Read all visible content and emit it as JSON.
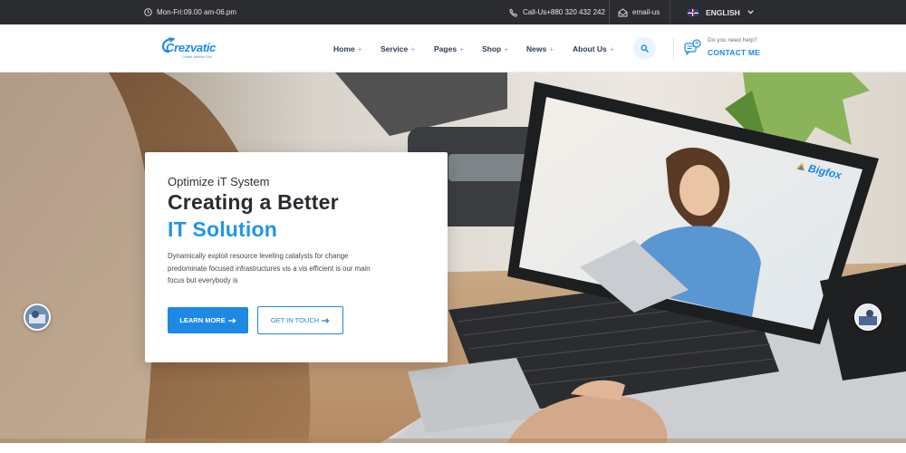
{
  "topbar": {
    "hours": "Mon-Fri:09.00 am-06.pm",
    "call": "Call-Us+880 320 432 242",
    "email": "email-us",
    "language": "ENGLISH",
    "icons": {
      "clock": "clock-icon",
      "phone": "phone-icon",
      "email": "email-icon",
      "flag": "uk-flag-icon",
      "chevron": "chevron-down-icon"
    }
  },
  "header": {
    "logo": {
      "name": "Crezvatic",
      "tagline": "Create Wealth Don"
    },
    "nav": [
      {
        "label": "Home",
        "plus": "+"
      },
      {
        "label": "Service",
        "plus": "+"
      },
      {
        "label": "Pages",
        "plus": "+"
      },
      {
        "label": "Shop",
        "plus": "+"
      },
      {
        "label": "News",
        "plus": "+"
      },
      {
        "label": "About Us",
        "plus": "+"
      }
    ],
    "help": {
      "question": "Do you need help?",
      "cta": "CONTACT ME"
    }
  },
  "hero": {
    "eyebrow": "Optimize iT System",
    "title_line1": "Creating a Better",
    "title_line2": "IT Solution",
    "description": "Dynamically exploit resource leveling catalysts for change predominate focused infrastructures vis a vis efficient is our main focus but everybody is",
    "primary_button": "LEARN MORE",
    "secondary_button": "GET IN TOUCH",
    "screen_brand": "Bigfox"
  },
  "colors": {
    "accent": "#1e88e5",
    "topbar_bg": "#2b2c30",
    "nav_text": "#2d3b52",
    "title_text": "#2a2c31"
  }
}
